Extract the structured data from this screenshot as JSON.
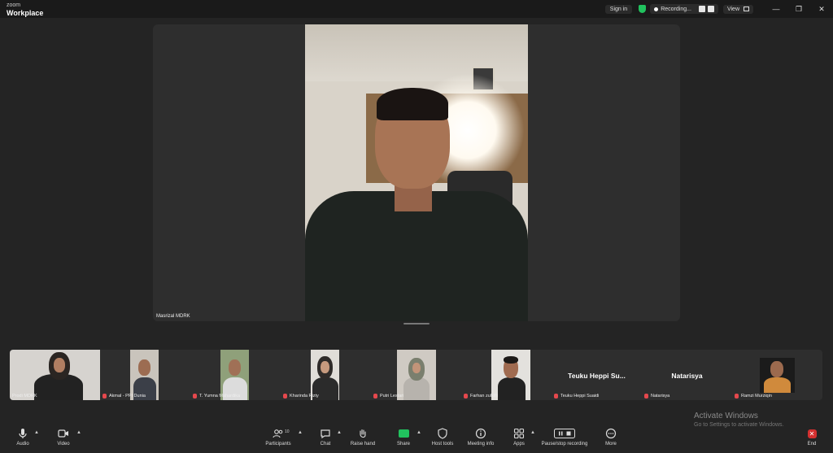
{
  "titlebar": {
    "logo_small": "zoom",
    "logo_big": "Workplace",
    "signin": "Sign in",
    "recording": "Recording...",
    "view": "View",
    "minimize": "—",
    "restore": "❐",
    "close": "✕"
  },
  "main_speaker": {
    "name": "Masrizal MDRK"
  },
  "participants": [
    {
      "name": "Prodi MDRK",
      "muted": false
    },
    {
      "name": "Akmal - PPI Dunia",
      "muted": true
    },
    {
      "name": "T. Yumna Mahardika",
      "muted": true
    },
    {
      "name": "Kharinda Rizty",
      "muted": true
    },
    {
      "name": "Putri Lestari",
      "muted": true
    },
    {
      "name": "Farhan zulkifli",
      "muted": true
    },
    {
      "name": "Teuku Heppi Suaidi",
      "muted": true,
      "display_text": "Teuku  Heppi  Su..."
    },
    {
      "name": "Natarisya",
      "muted": true,
      "display_text": "Natarisya"
    },
    {
      "name": "Ramzi Murziqin",
      "muted": true
    }
  ],
  "watermark": {
    "title": "Activate Windows",
    "subtitle": "Go to Settings to activate Windows."
  },
  "toolbar": {
    "audio": "Audio",
    "video": "Video",
    "participants": "Participants",
    "participants_count": "10",
    "chat": "Chat",
    "raise_hand": "Raise hand",
    "share": "Share",
    "host_tools": "Host tools",
    "meeting_info": "Meeting info",
    "apps": "Apps",
    "recording": "Pause/stop recording",
    "more": "More",
    "end": "End"
  },
  "colors": {
    "accent_green": "#21c25e",
    "mute_red": "#e5484d",
    "end_red": "#d32f2f"
  }
}
